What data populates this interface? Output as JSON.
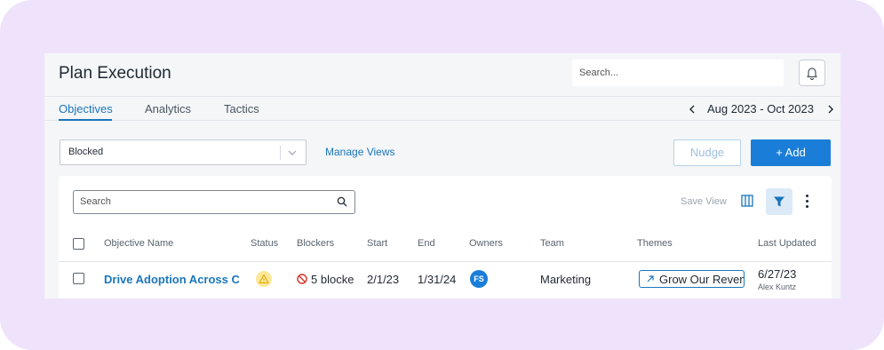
{
  "header": {
    "title": "Plan Execution",
    "search_placeholder": "Search...",
    "bell_icon": "bell-icon"
  },
  "tabs": [
    {
      "label": "Objectives",
      "active": true
    },
    {
      "label": "Analytics",
      "active": false
    },
    {
      "label": "Tactics",
      "active": false
    }
  ],
  "date_range": {
    "label": "Aug 2023 - Oct 2023",
    "prev_icon": "chevron-left-icon",
    "next_icon": "chevron-right-icon"
  },
  "toolbar": {
    "view_select_value": "Blocked",
    "manage_views_label": "Manage Views",
    "nudge_label": "Nudge",
    "add_label": "+ Add"
  },
  "panel": {
    "search_placeholder": "Search",
    "save_view_label": "Save View"
  },
  "table": {
    "columns": [
      "Objective Name",
      "Status",
      "Blockers",
      "Start",
      "End",
      "Owners",
      "Team",
      "Themes",
      "Last Updated"
    ],
    "rows": [
      {
        "objective_name": "Drive Adoption Across Cur",
        "status_icon": "warning-icon",
        "blockers": "5 blocke",
        "start": "2/1/23",
        "end": "1/31/24",
        "owner_initials": "FS",
        "team": "Marketing",
        "theme": "Grow Our Revenu",
        "last_updated_date": "6/27/23",
        "last_updated_by": "Alex Kuntz"
      }
    ]
  },
  "colors": {
    "accent": "#1a75bb",
    "primary_button": "#1a7ed8",
    "frame_background": "#efe3fb",
    "warning": "#fde89a",
    "blocker": "#d93025"
  }
}
